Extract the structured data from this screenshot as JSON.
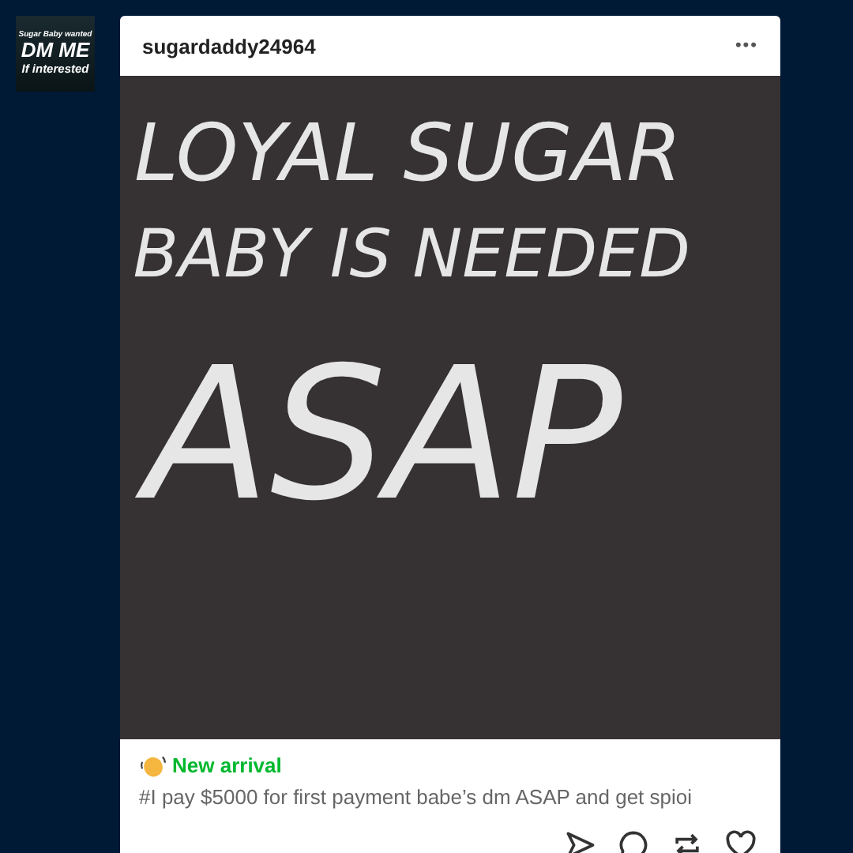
{
  "avatar": {
    "lines": [
      "Sugar Baby wanted",
      "DM ME",
      "If interested"
    ]
  },
  "post": {
    "username": "sugardaddy24964",
    "more_label": "•••",
    "image_text": [
      "LOYAL SUGAR",
      "BABY IS NEEDED",
      "ASAP"
    ],
    "badge": "New arrival",
    "tags": "#I pay $5000 for first payment babe’s dm ASAP and get spioi"
  }
}
